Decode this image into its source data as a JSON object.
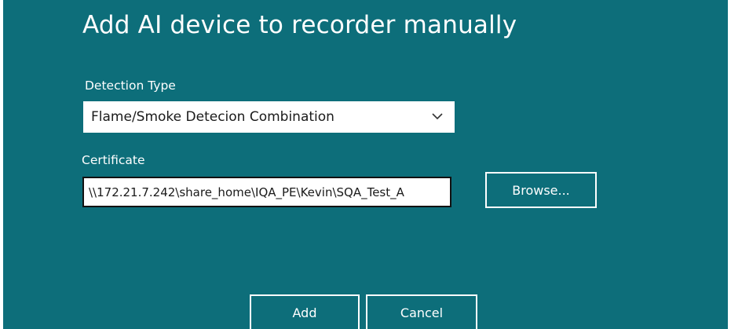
{
  "dialog": {
    "title": "Add AI device to recorder manually"
  },
  "detection_type": {
    "label": "Detection Type",
    "selected": "Flame/Smoke Detecion Combination",
    "chevron_icon": "chevron-down-icon"
  },
  "certificate": {
    "label": "Certificate",
    "value": "\\\\172.21.7.242\\share_home\\IQA_PE\\Kevin\\SQA_Test_A",
    "browse_label": "Browse..."
  },
  "actions": {
    "add_label": "Add",
    "cancel_label": "Cancel"
  },
  "colors": {
    "background": "#0d6e7a",
    "text": "#ffffff",
    "field_background": "#ffffff"
  }
}
